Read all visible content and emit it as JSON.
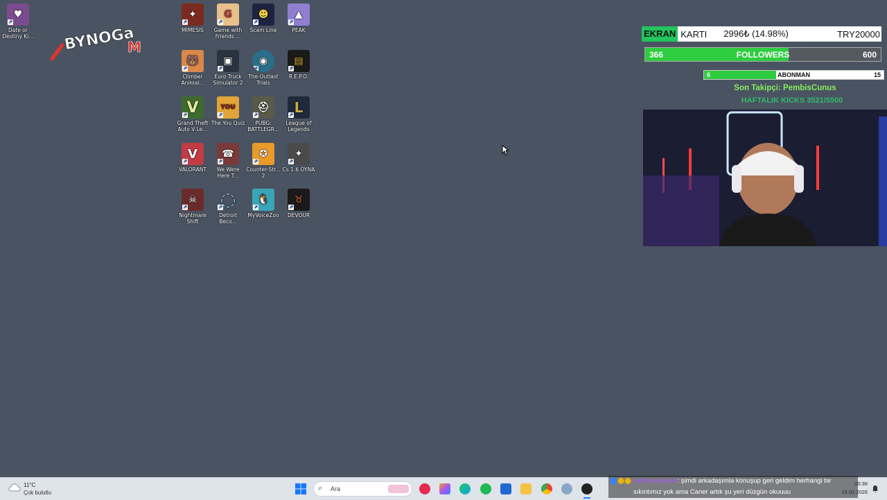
{
  "desktop_icons": [
    {
      "label": "Date or Destiny Ki...",
      "color": "#7a4b8f"
    },
    {
      "label": "MIMESIS",
      "color": "#7a2a1e"
    },
    {
      "label": "Game with Friends ...",
      "color": "#e7c08a"
    },
    {
      "label": "Scam Line",
      "color": "#1d2340"
    },
    {
      "label": "PEAK",
      "color": "#8f7fcf"
    },
    {
      "label": "Climber Animal...",
      "color": "#d9884a"
    },
    {
      "label": "Euro Truck Simulator 2",
      "color": "#2a3340"
    },
    {
      "label": "The Outlast Trials",
      "color": "#2a6f8a"
    },
    {
      "label": "R.E.P.O.",
      "color": "#e0b030"
    },
    {
      "label": "Grand Theft Auto V Le...",
      "color": "#3f6b2f"
    },
    {
      "label": "The You Quiz",
      "color": "#e3a53a"
    },
    {
      "label": "PUBG: BATTLEGR...",
      "color": "#5a5a4a"
    },
    {
      "label": "League of Legends",
      "color": "#1e2a3a"
    },
    {
      "label": "VALORANT",
      "color": "#c33c45"
    },
    {
      "label": "We Were Here T...",
      "color": "#7a3a3a"
    },
    {
      "label": "Counter-Str... 2",
      "color": "#e89a2a"
    },
    {
      "label": "Cs 1.6 OYNA",
      "color": "#4a4a4a"
    },
    {
      "label": "Nightmare Shift",
      "color": "#6b2b2b"
    },
    {
      "label": "Detroit Beco...",
      "color": "#e8eef6"
    },
    {
      "label": "MyVoiceZoo",
      "color": "#3aa5b8"
    },
    {
      "label": "DEVOUR",
      "color": "#1a1a1a"
    }
  ],
  "logo": {
    "text": "BYNOGaM"
  },
  "overlay": {
    "gpu_label_highlight": "EKRAN",
    "gpu_label_rest": "KARTI",
    "gpu_progress": "2996₺ (14.98%)",
    "gpu_goal": "TRY20000",
    "followers_current": "366",
    "followers_label": "FOLLOWERS",
    "followers_goal": "600",
    "followers_fraction": 0.61,
    "sub_current": "6",
    "sub_label": "ABONMAN",
    "sub_goal": "15",
    "sub_fraction": 0.4,
    "last_follower": "Son Takipçi: PembisCunus",
    "weekly_kicks": "HAFTALIK KICKS 3521/5500"
  },
  "taskbar": {
    "weather_temp": "11°C",
    "weather_desc": "Çok bulutlu",
    "search_placeholder": "Ara",
    "clock_time": "00:36",
    "clock_date": "15.02.2026"
  },
  "chat": {
    "username": "surfeeeeeeeee",
    "message": ": şimdi arkadaşımla konuşup geri geldim herhangi bir sıkıntımız yok ama Caner artık şu yeri düzgün okuuuu"
  }
}
